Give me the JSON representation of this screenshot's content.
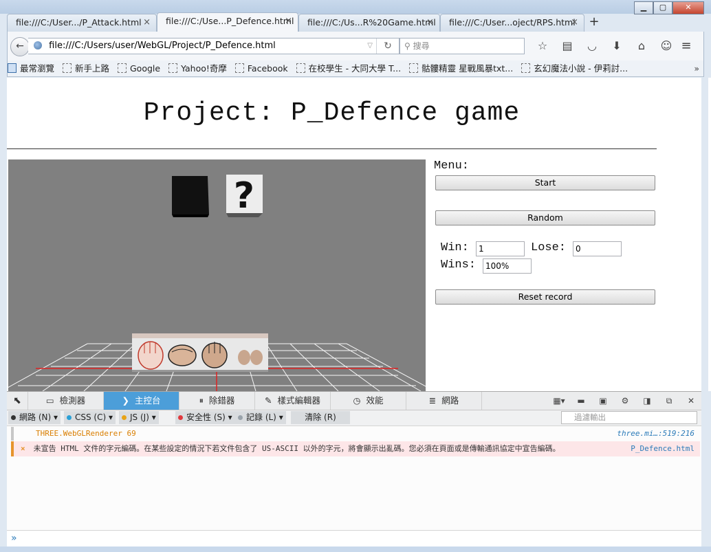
{
  "browser": {
    "tabs": [
      {
        "label": "file:///C:/User.../P_Attack.html",
        "active": false
      },
      {
        "label": "file:///C:/Use...P_Defence.html",
        "active": true
      },
      {
        "label": "file:///C:/Us...R%20Game.html",
        "active": false
      },
      {
        "label": "file:///C:/User...oject/RPS.html",
        "active": false
      }
    ],
    "close_glyph": "×",
    "new_tab_glyph": "+",
    "url": "file:///C:/Users/user/WebGL/Project/P_Defence.html",
    "search_placeholder": "搜尋",
    "bookmarks": [
      "最常瀏覽",
      "新手上路",
      "Google",
      "Yahoo!奇摩",
      "Facebook",
      "在校學生 - 大同大學 T...",
      "骷髏精靈 星戰風暴txt...",
      "玄幻魔法小說 - 伊莉討..."
    ],
    "nav_icons": [
      "bookmark-star-icon",
      "reading-list-icon",
      "pocket-icon",
      "download-icon",
      "home-icon",
      "chat-icon"
    ]
  },
  "page": {
    "title": "Project: P_Defence game",
    "menu_label": "Menu:",
    "start_label": "Start",
    "random_label": "Random",
    "win_label": "Win:",
    "win_value": "1",
    "lose_label": "Lose:",
    "lose_value": "0",
    "wins_label": "Wins:",
    "wins_value": "100%",
    "reset_label": "Reset record",
    "scene": {
      "question_mark": "?"
    }
  },
  "devtools": {
    "tabs": [
      "檢測器",
      "主控台",
      "除錯器",
      "樣式編輯器",
      "效能",
      "網路"
    ],
    "active_tab": "主控台",
    "filters": [
      {
        "label": "網路 (N)",
        "color": "#333333"
      },
      {
        "label": "CSS (C)",
        "color": "#2aa0d6"
      },
      {
        "label": "JS (J)",
        "color": "#e8a317"
      },
      {
        "label": "安全性 (S)",
        "color": "#e0393e"
      },
      {
        "label": "記錄 (L)",
        "color": "#9aa3ab"
      }
    ],
    "clear_label": "清除 (R)",
    "filter_placeholder": "過濾輸出",
    "logs": [
      {
        "text": "THREE.WebGLRenderer 69",
        "source": "three.mi…:519:216"
      },
      {
        "text": "未宣告 HTML 文件的字元編碼。在某些設定的情況下若文件包含了 US-ASCII 以外的字元，將會顯示出亂碼。您必須在頁面或是傳輸通訊協定中宣告編碼。",
        "source": "P_Defence.html",
        "marker": "×"
      }
    ],
    "prompt": "»"
  }
}
